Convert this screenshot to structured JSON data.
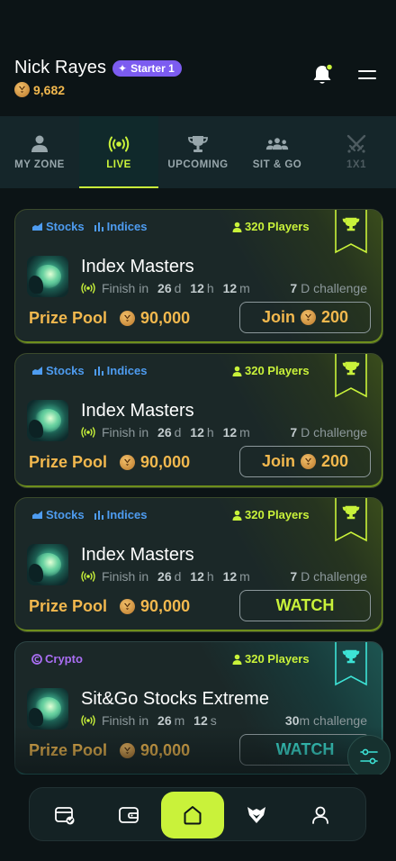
{
  "header": {
    "user_name": "Nick Rayes",
    "badge_label": "Starter 1",
    "coins": "9,682",
    "icons": [
      "bell-icon",
      "menu-icon",
      "coin-icon"
    ]
  },
  "tabs": [
    {
      "label": "MY ZONE",
      "icon": "person-icon"
    },
    {
      "label": "LIVE",
      "icon": "broadcast-icon",
      "active": true
    },
    {
      "label": "UPCOMING",
      "icon": "trophy-icon"
    },
    {
      "label": "SIT & GO",
      "icon": "group-icon"
    },
    {
      "label": "1X1",
      "icon": "crossed-swords-icon",
      "disabled": true
    }
  ],
  "cards": [
    {
      "tags": [
        "Stocks",
        "Indices"
      ],
      "players": "320 Players",
      "title": "Index Masters",
      "finish_prefix": "Finish in",
      "t1": "26",
      "u1": "d",
      "t2": "12",
      "u2": "h",
      "t3": "12",
      "u3": "m",
      "challenge_num": "7",
      "challenge_label": "D challenge",
      "prize_label": "Prize Pool",
      "prize": "90,000",
      "action": "Join",
      "action_cost": "200"
    },
    {
      "tags": [
        "Stocks",
        "Indices"
      ],
      "players": "320 Players",
      "title": "Index Masters",
      "finish_prefix": "Finish in",
      "t1": "26",
      "u1": "d",
      "t2": "12",
      "u2": "h",
      "t3": "12",
      "u3": "m",
      "challenge_num": "7",
      "challenge_label": "D challenge",
      "prize_label": "Prize Pool",
      "prize": "90,000",
      "action": "Join",
      "action_cost": "200"
    },
    {
      "tags": [
        "Stocks",
        "Indices"
      ],
      "players": "320 Players",
      "title": "Index Masters",
      "finish_prefix": "Finish in",
      "t1": "26",
      "u1": "d",
      "t2": "12",
      "u2": "h",
      "t3": "12",
      "u3": "m",
      "challenge_num": "7",
      "challenge_label": "D challenge",
      "prize_label": "Prize Pool",
      "prize": "90,000",
      "action": "WATCH"
    },
    {
      "tags": [
        "Crypto"
      ],
      "players": "320 Players",
      "title": "Sit&Go Stocks Extreme",
      "finish_prefix": "Finish in",
      "t2": "26",
      "u2": "m",
      "t3": "12",
      "u3": "s",
      "challenge_num": "30",
      "challenge_label": "m challenge",
      "prize_label": "Prize Pool",
      "prize": "90,000",
      "action": "WATCH"
    }
  ],
  "bottom_nav": [
    "wallet-check-icon",
    "wallet-icon",
    "home-icon",
    "fox-icon",
    "profile-icon"
  ],
  "colors": {
    "accent": "#c9f23a",
    "gold": "#f2b84e",
    "badge": "#7c5cf0",
    "stocks": "#4e9cf0",
    "crypto": "#a96ef2"
  }
}
